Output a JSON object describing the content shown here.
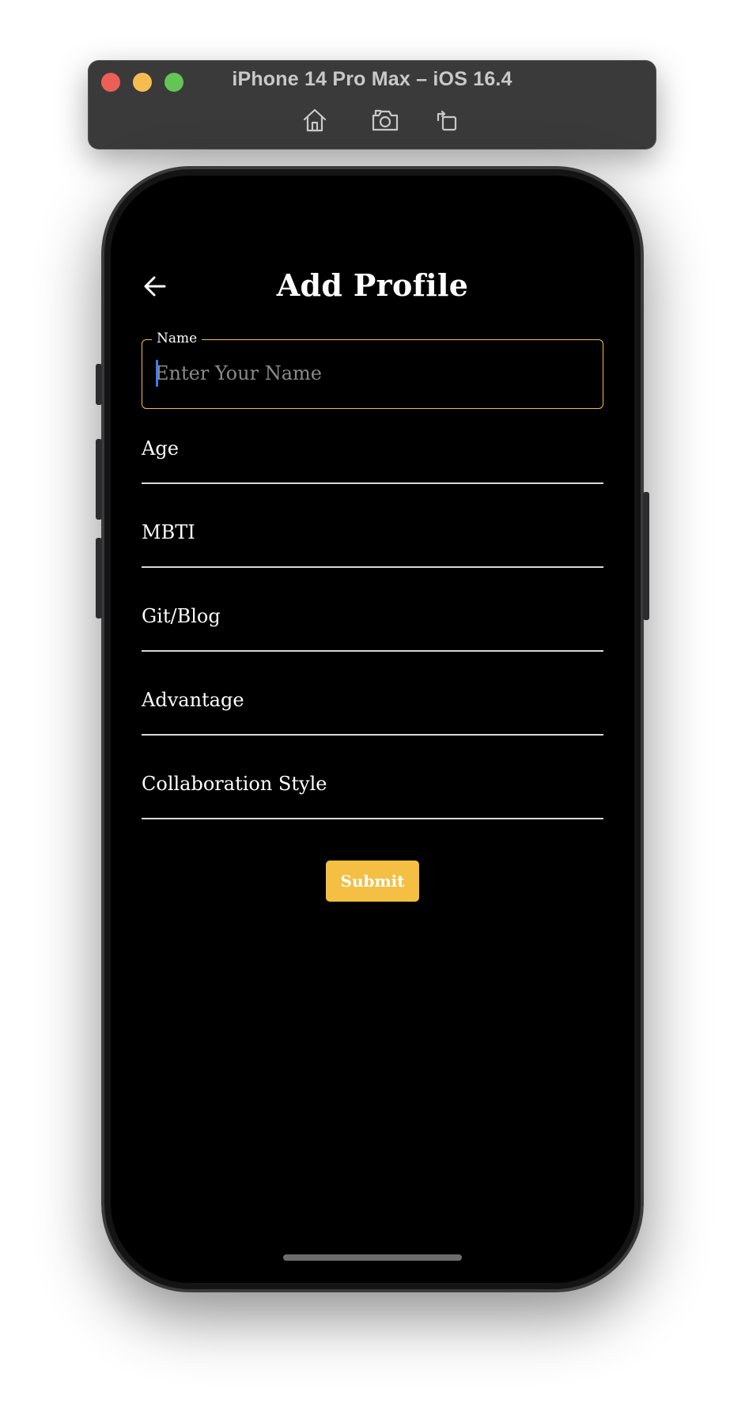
{
  "simulator": {
    "title": "iPhone 14 Pro Max – iOS 16.4",
    "toolbar": [
      "home-icon",
      "screenshot-icon",
      "rotate-icon"
    ]
  },
  "app": {
    "title": "Add Profile",
    "back_icon": "arrow-left-icon",
    "name_field": {
      "label": "Name",
      "placeholder": "Enter Your Name",
      "value": ""
    },
    "fields": [
      {
        "label": "Age"
      },
      {
        "label": "MBTI"
      },
      {
        "label": "Git/Blog"
      },
      {
        "label": "Advantage"
      },
      {
        "label": "Collaboration Style"
      }
    ],
    "submit_label": "Submit"
  },
  "colors": {
    "accent": "#f4bf42",
    "background": "#000000",
    "caret": "#3e7bf6"
  }
}
